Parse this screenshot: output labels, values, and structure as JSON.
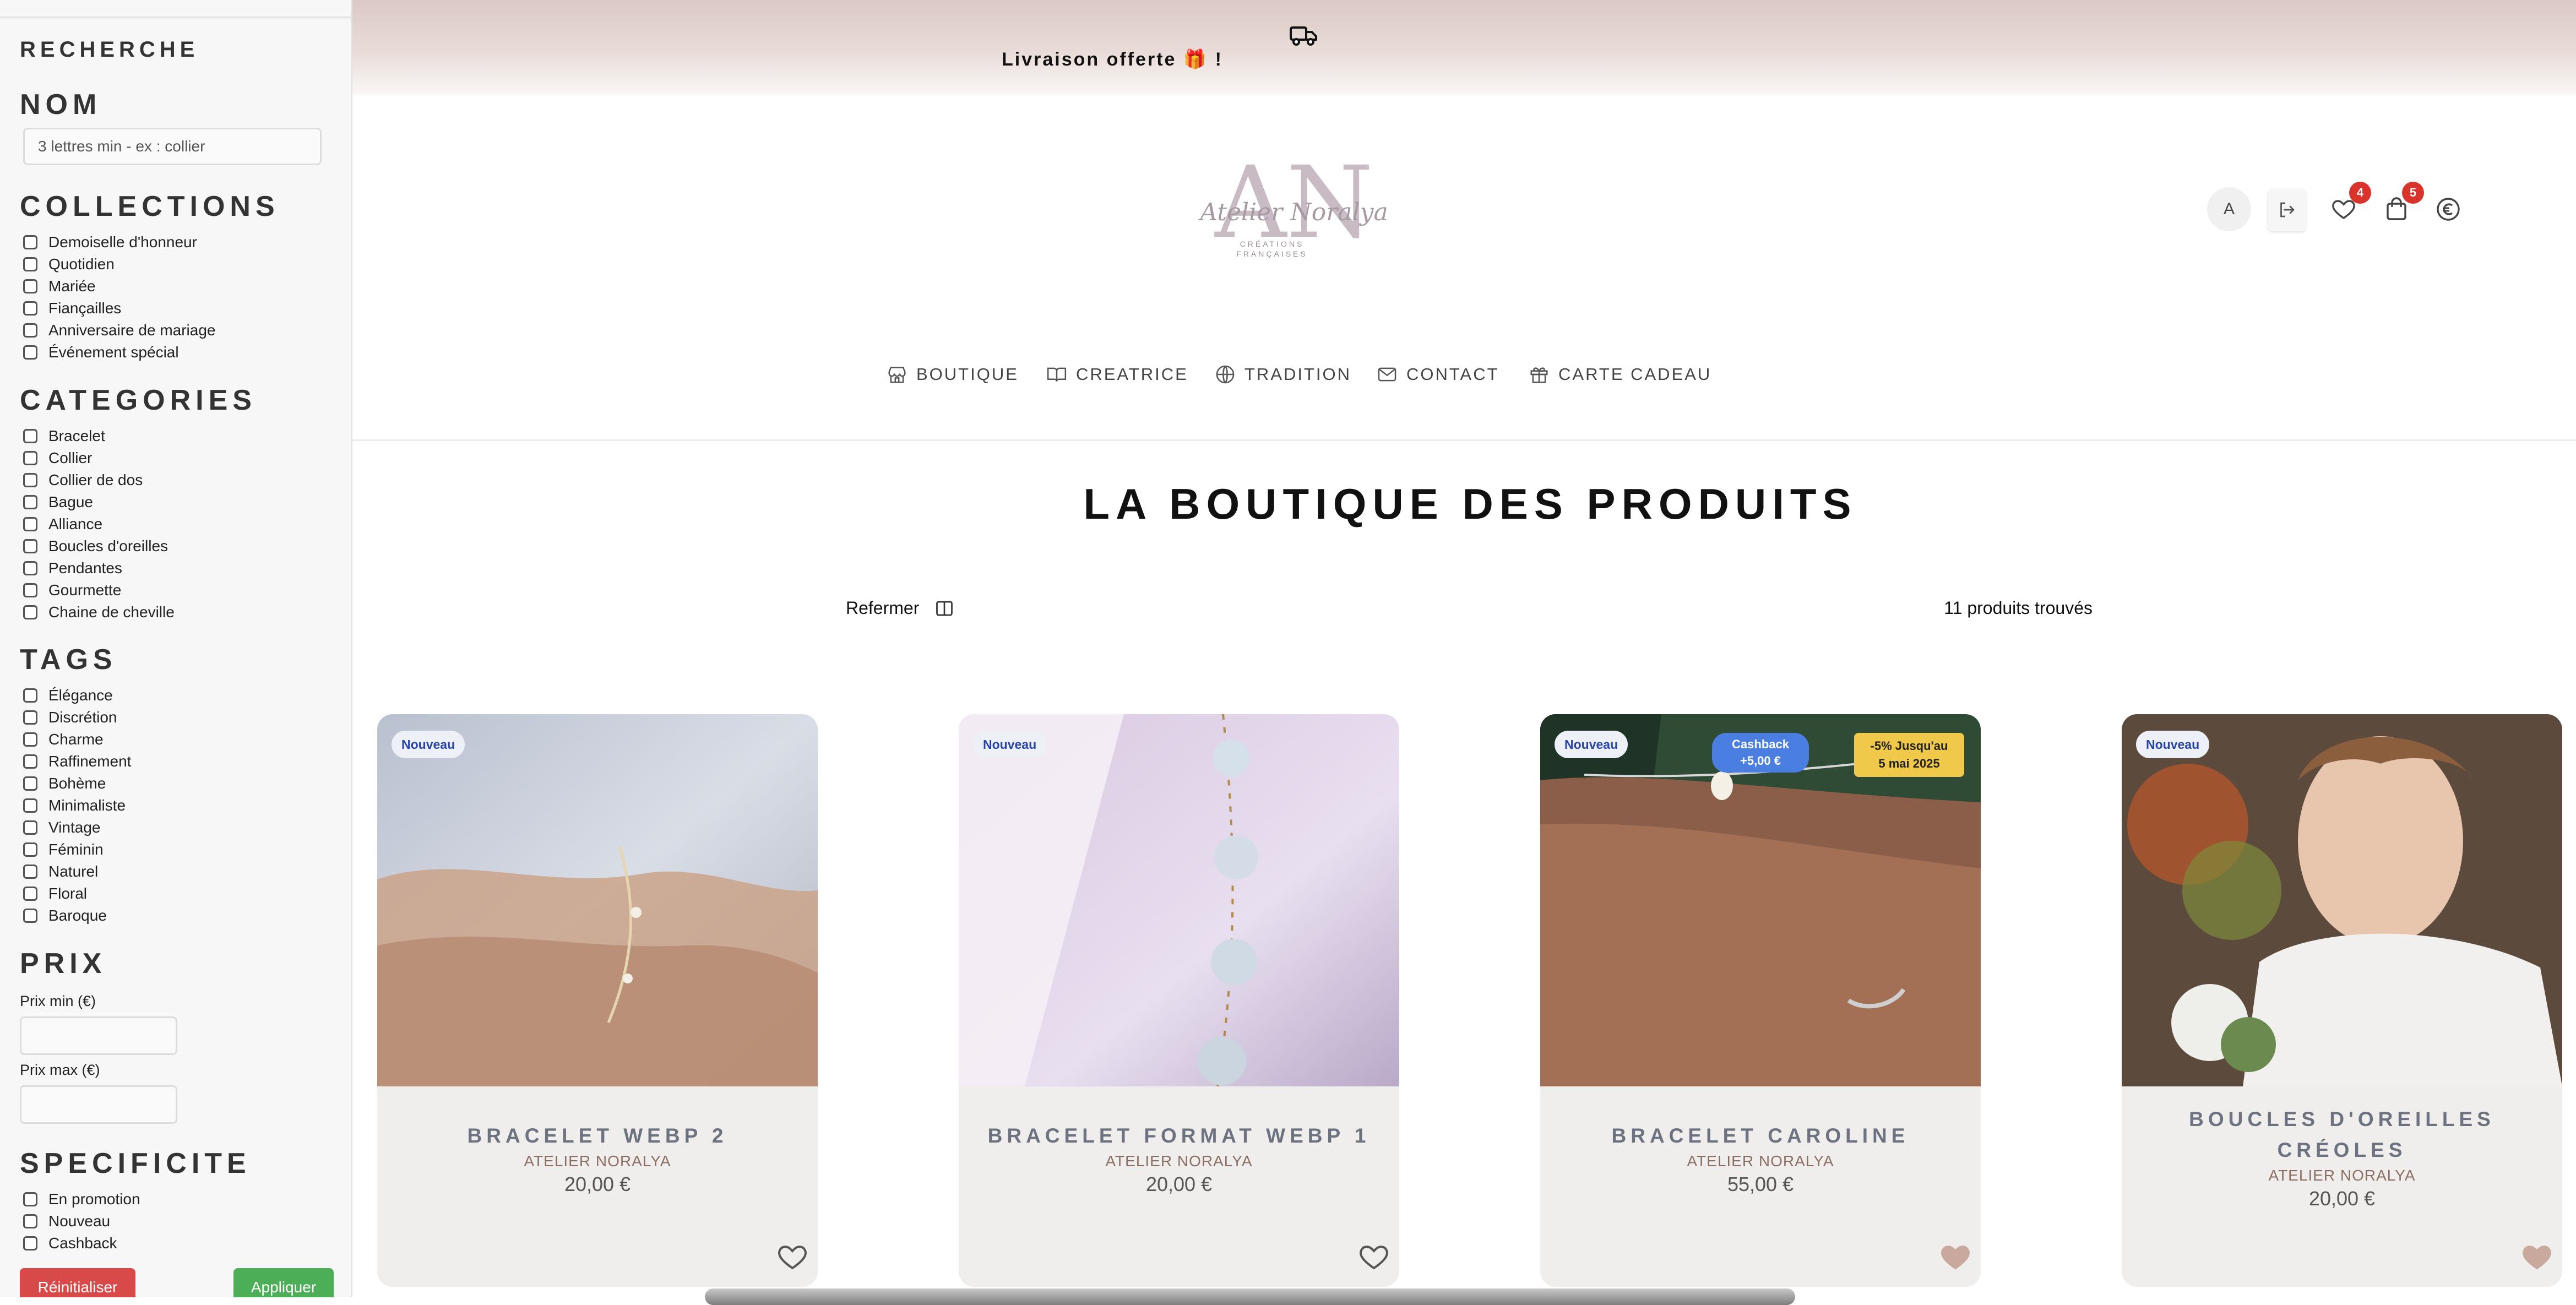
{
  "sidebar": {
    "title": "RECHERCHE",
    "name_heading": "NOM",
    "name_placeholder": "3 lettres min - ex : collier",
    "collections_heading": "COLLECTIONS",
    "collections": [
      "Demoiselle d'honneur",
      "Quotidien",
      "Mariée",
      "Fiançailles",
      "Anniversaire de mariage",
      "Événement spécial"
    ],
    "categories_heading": "CATEGORIES",
    "categories": [
      "Bracelet",
      "Collier",
      "Collier de dos",
      "Bague",
      "Alliance",
      "Boucles d'oreilles",
      "Pendantes",
      "Gourmette",
      "Chaine de cheville"
    ],
    "tags_heading": "TAGS",
    "tags": [
      "Élégance",
      "Discrétion",
      "Charme",
      "Raffinement",
      "Bohème",
      "Minimaliste",
      "Vintage",
      "Féminin",
      "Naturel",
      "Floral",
      "Baroque"
    ],
    "price_heading": "PRIX",
    "price_min_label": "Prix min (€)",
    "price_max_label": "Prix max (€)",
    "spec_heading": "SPECIFICITE",
    "specificities": [
      "En promotion",
      "Nouveau",
      "Cashback"
    ],
    "reset_label": "Réinitialiser",
    "apply_label": "Appliquer"
  },
  "banner": {
    "text": "Livraison offerte 🎁 !",
    "icon": "truck-icon"
  },
  "header": {
    "logo_initials": "AN",
    "logo_script": "Atelier Noralya",
    "logo_sub1": "CRÉATIONS",
    "logo_sub2": "FRANÇAISES",
    "avatar_letter": "A",
    "wishlist_count": "4",
    "cart_count": "5"
  },
  "nav": [
    {
      "label": "BOUTIQUE",
      "icon": "store-icon"
    },
    {
      "label": "CREATRICE",
      "icon": "book-icon"
    },
    {
      "label": "TRADITION",
      "icon": "globe-icon"
    },
    {
      "label": "CONTACT",
      "icon": "mail-icon"
    },
    {
      "label": "CARTE CADEAU",
      "icon": "gift-icon"
    }
  ],
  "main": {
    "title": "LA BOUTIQUE DES PRODUITS",
    "toggle_label": "Refermer",
    "count_text": "11 produits trouvés"
  },
  "products": [
    {
      "name": "BRACELET WEBP 2",
      "brand": "ATELIER NORALYA",
      "price": "20,00 €",
      "badge": "Nouveau",
      "liked": false
    },
    {
      "name": "BRACELET FORMAT WEBP 1",
      "brand": "ATELIER NORALYA",
      "price": "20,00 €",
      "badge": "Nouveau",
      "liked": false
    },
    {
      "name": "BRACELET CAROLINE",
      "brand": "ATELIER NORALYA",
      "price": "55,00 €",
      "badge": "Nouveau",
      "cashback_1": "Cashback",
      "cashback_2": "+5,00 €",
      "promo_1": "-5% Jusqu'au",
      "promo_2": "5 mai 2025",
      "liked": true
    },
    {
      "name_1": "BOUCLES D'OREILLES",
      "name_2": "CRÉOLES",
      "brand": "ATELIER NORALYA",
      "price": "20,00 €",
      "badge": "Nouveau",
      "liked": true
    }
  ],
  "colors": {
    "heart_filled": "#c9a89e",
    "badge_red": "#d9342b",
    "reset": "#d84a4a",
    "apply": "#4caf58"
  }
}
